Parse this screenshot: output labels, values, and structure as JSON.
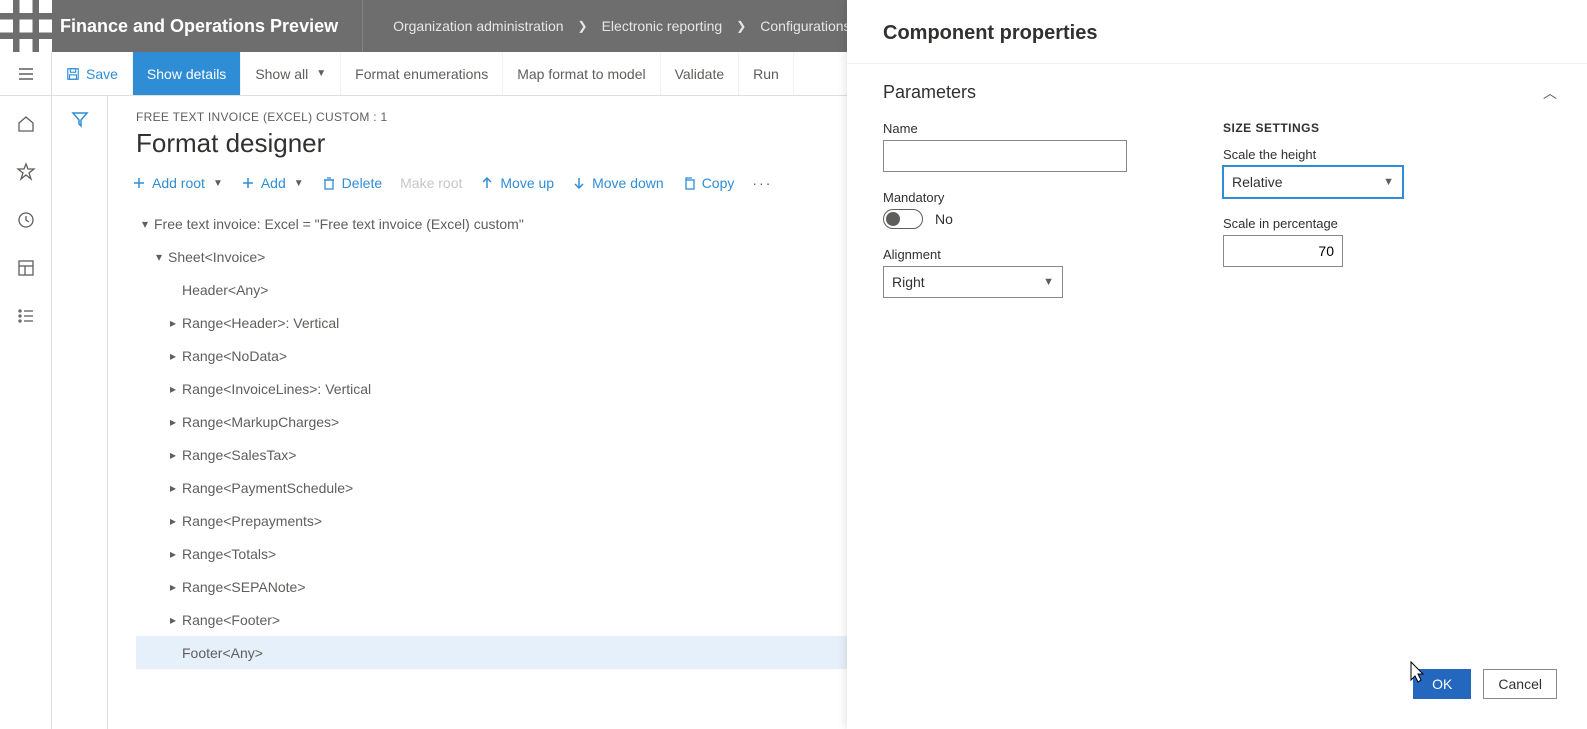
{
  "app_title": "Finance and Operations Preview",
  "breadcrumbs": [
    "Organization administration",
    "Electronic reporting",
    "Configurations"
  ],
  "help_tooltip": "?",
  "commandbar": {
    "save": "Save",
    "show_details": "Show details",
    "show_all": "Show all",
    "format_enum": "Format enumerations",
    "map_format": "Map format to model",
    "validate": "Validate",
    "run": "Run"
  },
  "context_path": "FREE TEXT INVOICE (EXCEL) CUSTOM : 1",
  "page_title": "Format designer",
  "toolbar": {
    "add_root": "Add root",
    "add": "Add",
    "delete": "Delete",
    "make_root": "Make root",
    "move_up": "Move up",
    "move_down": "Move down",
    "copy": "Copy",
    "more": "···"
  },
  "tree": [
    {
      "level": 0,
      "caret": "down",
      "text": "Free text invoice: Excel = \"Free text invoice (Excel) custom\"",
      "selected": false
    },
    {
      "level": 1,
      "caret": "down",
      "text": "Sheet<Invoice>",
      "selected": false
    },
    {
      "level": 2,
      "caret": "none",
      "text": "Header<Any>",
      "selected": false
    },
    {
      "level": 2,
      "caret": "right",
      "text": "Range<Header>: Vertical",
      "selected": false
    },
    {
      "level": 2,
      "caret": "right",
      "text": "Range<NoData>",
      "selected": false
    },
    {
      "level": 2,
      "caret": "right",
      "text": "Range<InvoiceLines>: Vertical",
      "selected": false
    },
    {
      "level": 2,
      "caret": "right",
      "text": "Range<MarkupCharges>",
      "selected": false
    },
    {
      "level": 2,
      "caret": "right",
      "text": "Range<SalesTax>",
      "selected": false
    },
    {
      "level": 2,
      "caret": "right",
      "text": "Range<PaymentSchedule>",
      "selected": false
    },
    {
      "level": 2,
      "caret": "right",
      "text": "Range<Prepayments>",
      "selected": false
    },
    {
      "level": 2,
      "caret": "right",
      "text": "Range<Totals>",
      "selected": false
    },
    {
      "level": 2,
      "caret": "right",
      "text": "Range<SEPANote>",
      "selected": false
    },
    {
      "level": 2,
      "caret": "right",
      "text": "Range<Footer>",
      "selected": false
    },
    {
      "level": 2,
      "caret": "none",
      "text": "Footer<Any>",
      "selected": true
    }
  ],
  "panel": {
    "title": "Component properties",
    "section_title": "Parameters",
    "name_label": "Name",
    "name_value": "",
    "mandatory_label": "Mandatory",
    "mandatory_value": "No",
    "alignment_label": "Alignment",
    "alignment_value": "Right",
    "size_settings_label": "SIZE SETTINGS",
    "scale_height_label": "Scale the height",
    "scale_height_value": "Relative",
    "scale_percent_label": "Scale in percentage",
    "scale_percent_value": "70",
    "ok": "OK",
    "cancel": "Cancel"
  }
}
